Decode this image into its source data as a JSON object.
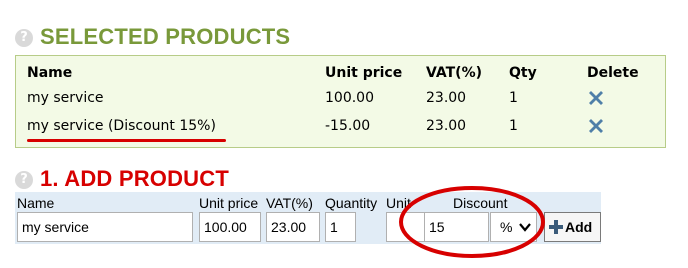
{
  "selected_products": {
    "title": "SELECTED PRODUCTS",
    "help_glyph": "?",
    "columns": {
      "name": "Name",
      "unit_price": "Unit price",
      "vat": "VAT(%)",
      "qty": "Qty",
      "delete": "Delete"
    },
    "rows": [
      {
        "name": "my service",
        "unit_price": "100.00",
        "vat": "23.00",
        "qty": "1",
        "delete_icon": "close-x-icon"
      },
      {
        "name": "my service (Discount 15%)",
        "unit_price": "-15.00",
        "vat": "23.00",
        "qty": "1",
        "delete_icon": "close-x-icon"
      }
    ],
    "colors": {
      "title": "#79993a",
      "box_bg": "#f3fae6",
      "box_border": "#b7cc88",
      "delete_icon": "#4f7fa8",
      "highlight": "#d70000"
    }
  },
  "add_product": {
    "title": "1. ADD PRODUCT",
    "help_glyph": "?",
    "labels": {
      "name": "Name",
      "unit_price": "Unit price",
      "vat": "VAT(%)",
      "quantity": "Quantity",
      "unit": "Unit",
      "discount": "Discount"
    },
    "values": {
      "name": "my service",
      "unit_price": "100.00",
      "vat": "23.00",
      "quantity": "1",
      "unit": "",
      "discount": "15",
      "discount_type": "%"
    },
    "add_button": {
      "label": "Add",
      "icon": "plus-icon"
    },
    "colors": {
      "title": "#d70000",
      "row_bg": "#e1ecf6"
    }
  }
}
